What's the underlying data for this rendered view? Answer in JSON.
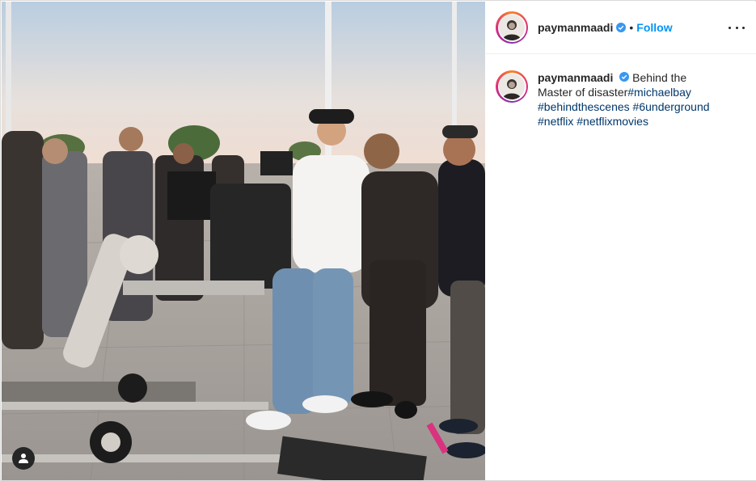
{
  "post": {
    "image_alt": "Behind the scenes film set photo",
    "tagged_users_icon": "user-silhouette-icon"
  },
  "header": {
    "username": "paymanmaadi",
    "verified_icon": "verified-badge-icon",
    "separator": "•",
    "follow_label": "Follow",
    "more_icon": "more-options-icon"
  },
  "caption": {
    "username": "paymanmaadi",
    "text_before": "Behind the Master of disaster",
    "hashtags": [
      "#michaelbay",
      "#behindthescenes",
      "#6underground",
      "#netflix",
      "#netflixmovies"
    ]
  },
  "colors": {
    "accent": "#0095f6",
    "hashtag": "#00376b",
    "verified": "#3897f0"
  }
}
